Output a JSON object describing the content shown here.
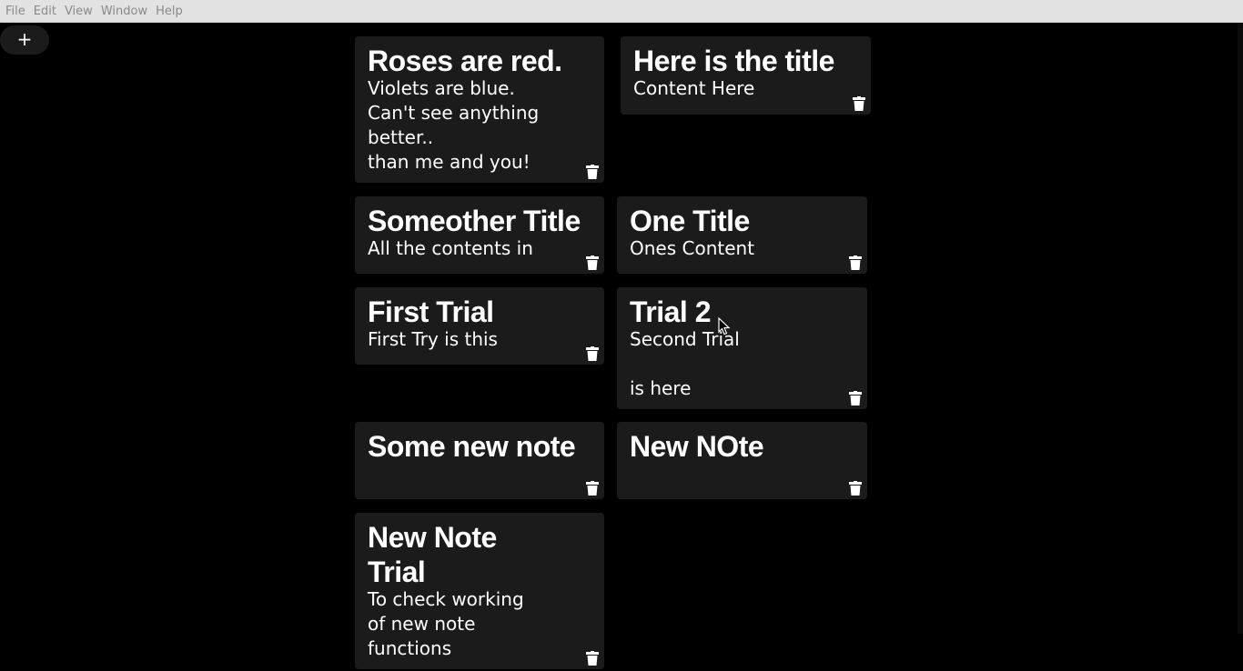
{
  "menubar": {
    "items": [
      "File",
      "Edit",
      "View",
      "Window",
      "Help"
    ]
  },
  "toolbar": {
    "add_label": "+"
  },
  "notes": [
    {
      "title": "Roses are red.",
      "content": "Violets are blue.\nCan't see anything\nbetter..\nthan me and you!"
    },
    {
      "title": "Here is the title",
      "content": "Content Here"
    },
    {
      "title": "Someother Title",
      "content": "All the contents in"
    },
    {
      "title": "One Title",
      "content": "Ones Content"
    },
    {
      "title": "First Trial",
      "content": "First Try is this"
    },
    {
      "title": "Trial 2",
      "content": "Second Trial\n\nis here"
    },
    {
      "title": "Some new note",
      "content": ""
    },
    {
      "title": "New NOte",
      "content": ""
    },
    {
      "title": "New Note\nTrial",
      "content": "To check working\nof new note\nfunctions"
    }
  ],
  "icons": {
    "delete": "trash-icon",
    "add": "plus-icon"
  },
  "colors": {
    "background": "#000000",
    "card": "#1b1b1b",
    "text": "#ffffff",
    "menubar": "#e2e2e2"
  }
}
